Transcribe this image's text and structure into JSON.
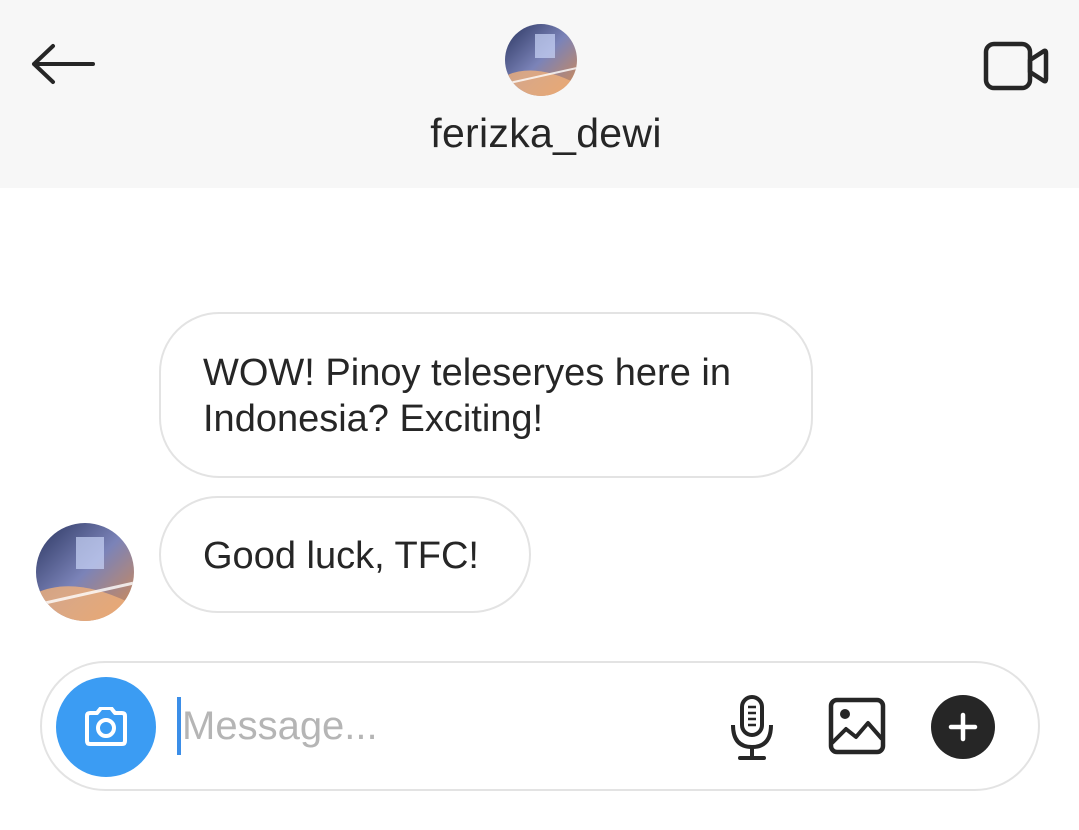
{
  "header": {
    "username": "ferizka_dewi",
    "back_icon": "arrow-left-icon",
    "video_icon": "video-camera-icon",
    "avatar": "profile-avatar"
  },
  "messages": [
    {
      "text": "WOW! Pinoy teleseryes here in Indonesia? Exciting!",
      "from": "ferizka_dewi"
    },
    {
      "text": "Good luck, TFC!",
      "from": "ferizka_dewi"
    }
  ],
  "composer": {
    "value": "",
    "placeholder": "Message...",
    "camera_icon": "camera-icon",
    "mic_icon": "microphone-icon",
    "gallery_icon": "image-gallery-icon",
    "plus_icon": "plus-icon",
    "accent_color": "#3b9cf3"
  }
}
